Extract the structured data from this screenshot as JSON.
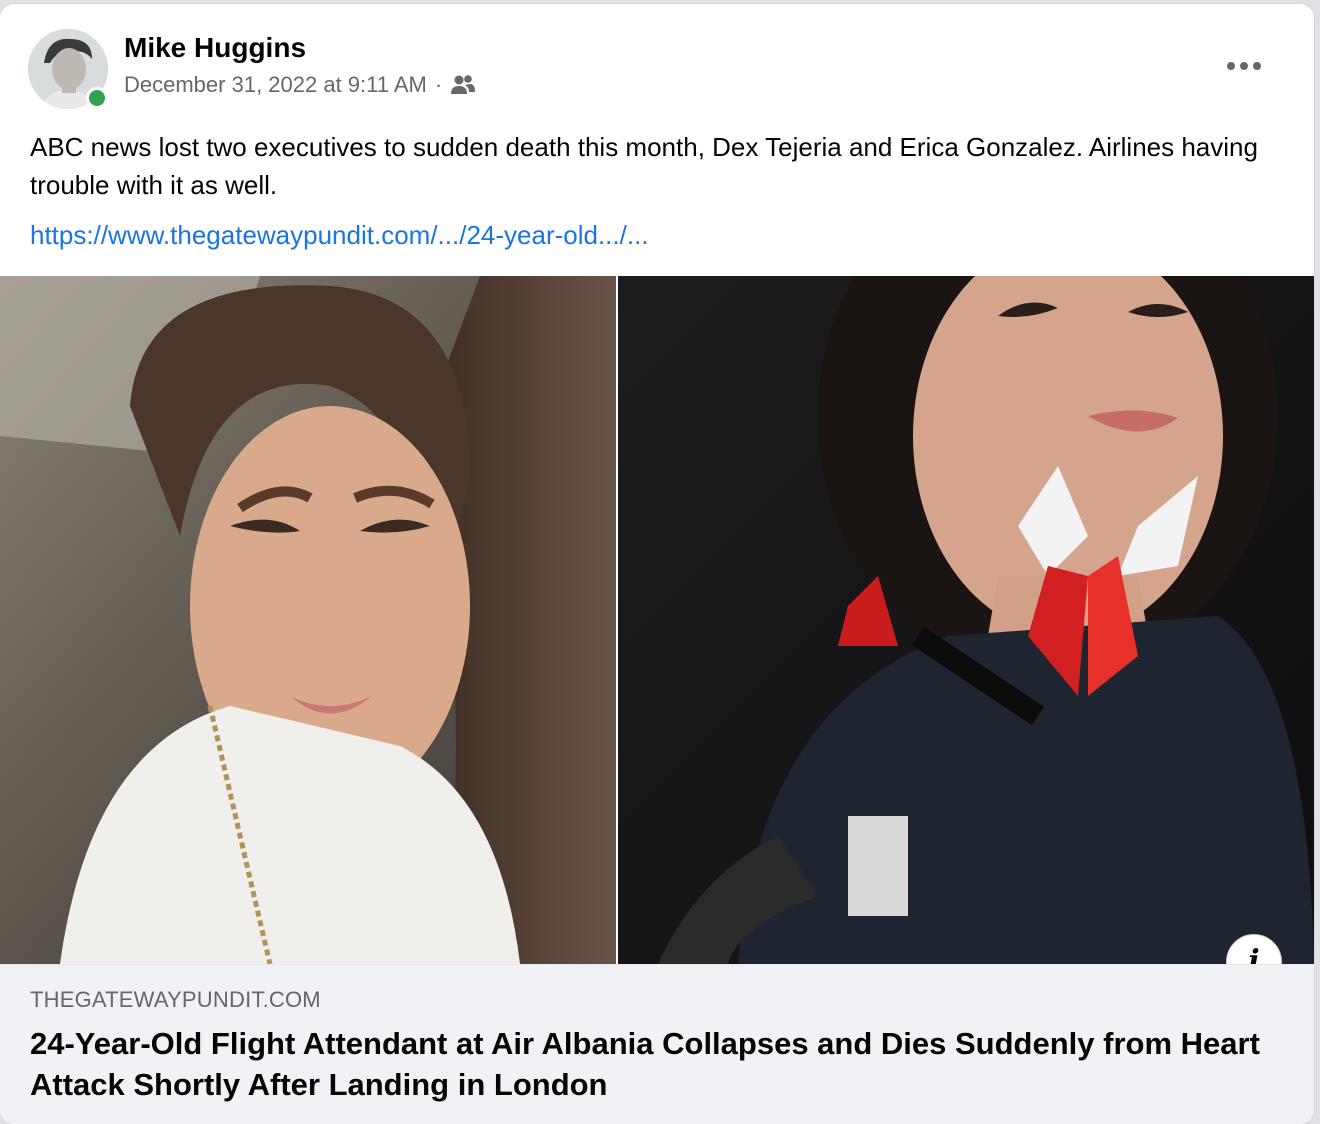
{
  "post": {
    "author": "Mike Huggins",
    "timestamp": "December 31, 2022 at 9:11 AM",
    "separator": "·",
    "audience_icon": "friends-icon",
    "more_icon": "more-options-icon",
    "online_status_color": "#31a24c",
    "text": "ABC news lost two executives to sudden death this month, Dex Tejeria and Erica Gonzalez. Airlines having trouble with it as well.",
    "link_text": "https://www.thegatewaypundit.com/.../24-year-old.../..."
  },
  "link_preview": {
    "domain": "THEGATEWAYPUNDIT.COM",
    "title": "24-Year-Old Flight Attendant at Air Albania Collapses and Dies Suddenly from Heart Attack Shortly After Landing in London",
    "info_icon": "info-icon",
    "info_glyph": "i"
  },
  "colors": {
    "link_blue": "#1b74e4",
    "secondary_text": "#65676b",
    "preview_bg": "#f0f2f5"
  }
}
